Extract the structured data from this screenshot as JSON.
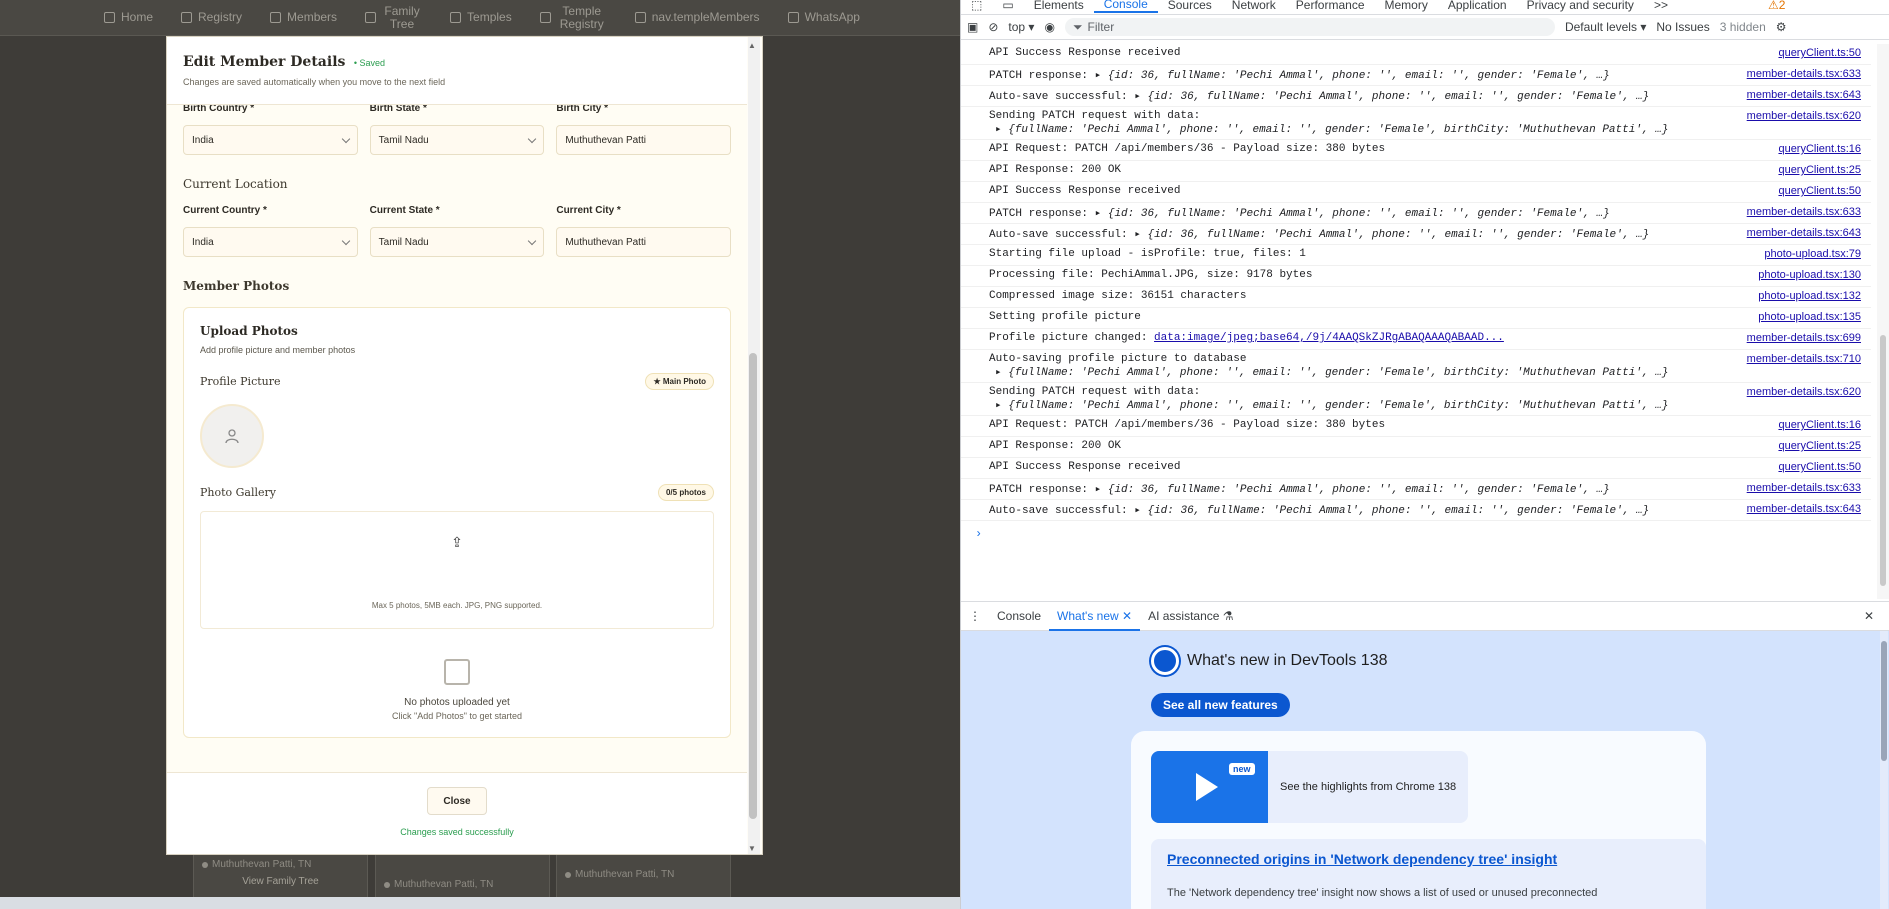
{
  "nav": {
    "items": [
      {
        "icon": "home-icon",
        "label": "Home"
      },
      {
        "icon": "registry-icon",
        "label": "Registry"
      },
      {
        "icon": "members-icon",
        "label": "Members"
      },
      {
        "icon": "tree-icon",
        "label": "Family Tree"
      },
      {
        "icon": "temple-icon",
        "label": "Temples"
      },
      {
        "icon": "registry2-icon",
        "label": "Temple Registry"
      },
      {
        "icon": "temples-members-icon",
        "label": "nav.templeMembers"
      },
      {
        "icon": "whatsapp-icon",
        "label": "WhatsApp"
      }
    ]
  },
  "background": {
    "card1_loc": "Muthuthevan Patti, TN",
    "card1_link": "View Family Tree",
    "card2_loc": "Muthuthevan Patti, TN",
    "card3_loc": "Muthuthevan Patti, TN"
  },
  "modal": {
    "title": "Edit Member Details",
    "saved": "Saved",
    "subtitle": "Changes are saved automatically when you move to the next field",
    "birth_country_label": "Birth Country *",
    "birth_country_value": "India",
    "birth_state_label": "Birth State *",
    "birth_state_value": "Tamil Nadu",
    "birth_city_label": "Birth City *",
    "birth_city_value": "Muthuthevan Patti",
    "current_location_title": "Current Location",
    "current_country_label": "Current Country *",
    "current_country_value": "India",
    "current_state_label": "Current State *",
    "current_state_value": "Tamil Nadu",
    "current_city_label": "Current City *",
    "current_city_value": "Muthuthevan Patti",
    "member_photos_title": "Member Photos",
    "upload_title": "Upload Photos",
    "upload_sub": "Add profile picture and member photos",
    "profile_picture_title": "Profile Picture",
    "main_photo_badge": "Main Photo",
    "photo_gallery_title": "Photo Gallery",
    "gallery_count": "0/5 photos",
    "dropzone_hint": "Max 5 photos, 5MB each. JPG, PNG supported.",
    "empty_title": "No photos uploaded yet",
    "empty_sub": "Click \"Add Photos\" to get started",
    "close_button": "Close",
    "saved_message": "Changes saved successfully"
  },
  "devtools": {
    "tabs": [
      "Elements",
      "Console",
      "Sources",
      "Network",
      "Performance",
      "Memory",
      "Application",
      "Privacy and security"
    ],
    "more_tabs": ">>",
    "warnings": "2",
    "context": "top",
    "filter_placeholder": "Filter",
    "levels": "Default levels",
    "issues": "No Issues",
    "hidden": "3 hidden",
    "logs": [
      {
        "msg": "API Success Response received",
        "src": "queryClient.ts:50"
      },
      {
        "msg": "PATCH response: ",
        "obj": "{id: 36, fullName: 'Pechi Ammal', phone: '', email: '', gender: 'Female', …}",
        "src": "member-details.tsx:633"
      },
      {
        "msg": "Auto-save successful: ",
        "obj": "{id: 36, fullName: 'Pechi Ammal', phone: '', email: '', gender: 'Female', …}",
        "src": "member-details.tsx:643"
      },
      {
        "msg": "Sending PATCH request with data:",
        "obj2": "{fullName: 'Pechi Ammal', phone: '', email: '', gender: 'Female', birthCity: 'Muthuthevan Patti', …}",
        "src": "member-details.tsx:620"
      },
      {
        "msg": "API Request: PATCH /api/members/36 - Payload size: 380 bytes",
        "src": "queryClient.ts:16"
      },
      {
        "msg": "API Response: 200 OK",
        "src": "queryClient.ts:25"
      },
      {
        "msg": "API Success Response received",
        "src": "queryClient.ts:50"
      },
      {
        "msg": "PATCH response: ",
        "obj": "{id: 36, fullName: 'Pechi Ammal', phone: '', email: '', gender: 'Female', …}",
        "src": "member-details.tsx:633"
      },
      {
        "msg": "Auto-save successful: ",
        "obj": "{id: 36, fullName: 'Pechi Ammal', phone: '', email: '', gender: 'Female', …}",
        "src": "member-details.tsx:643"
      },
      {
        "msg": "Starting file upload - isProfile: true, files: 1",
        "src": "photo-upload.tsx:79"
      },
      {
        "msg": "Processing file: PechiAmmal.JPG, size: 9178 bytes",
        "src": "photo-upload.tsx:130"
      },
      {
        "msg": "Compressed image size: 36151 characters",
        "src": "photo-upload.tsx:132"
      },
      {
        "msg": "Setting profile picture",
        "src": "photo-upload.tsx:135"
      },
      {
        "msg": "Profile picture changed: ",
        "link": "data:image/jpeg;base64,/9j/4AAQSkZJRgABAQAAAQABAAD...",
        "src": "member-details.tsx:699"
      },
      {
        "msg": "Auto-saving profile picture to database",
        "obj2": "{fullName: 'Pechi Ammal', phone: '', email: '', gender: 'Female', birthCity: 'Muthuthevan Patti', …}",
        "src": "member-details.tsx:710"
      },
      {
        "msg": "Sending PATCH request with data:",
        "obj2": "{fullName: 'Pechi Ammal', phone: '', email: '', gender: 'Female', birthCity: 'Muthuthevan Patti', …}",
        "src": "member-details.tsx:620"
      },
      {
        "msg": "API Request: PATCH /api/members/36 - Payload size: 380 bytes",
        "src": "queryClient.ts:16"
      },
      {
        "msg": "API Response: 200 OK",
        "src": "queryClient.ts:25"
      },
      {
        "msg": "API Success Response received",
        "src": "queryClient.ts:50"
      },
      {
        "msg": "PATCH response: ",
        "obj": "{id: 36, fullName: 'Pechi Ammal', phone: '', email: '', gender: 'Female', …}",
        "src": "member-details.tsx:633"
      },
      {
        "msg": "Auto-save successful: ",
        "obj": "{id: 36, fullName: 'Pechi Ammal', phone: '', email: '', gender: 'Female', …}",
        "src": "member-details.tsx:643"
      }
    ],
    "drawer_tabs": [
      "Console",
      "What's new",
      "AI assistance"
    ],
    "whats_new_title": "What's new in DevTools 138",
    "see_all": "See all new features",
    "new_badge": "new",
    "highlights_text": "See the highlights from Chrome 138",
    "insight_title": "Preconnected origins in 'Network dependency tree' insight",
    "insight_body": "The 'Network dependency tree' insight now shows a list of used or unused preconnected"
  }
}
